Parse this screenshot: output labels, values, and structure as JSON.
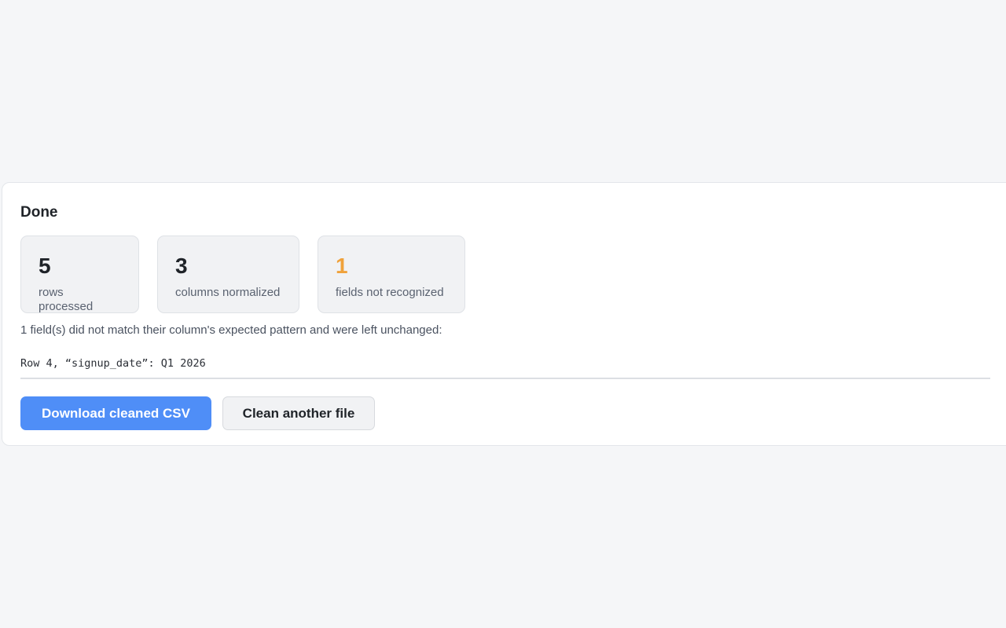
{
  "result": {
    "title": "Done",
    "stats": [
      {
        "value": "5",
        "label": "rows processed"
      },
      {
        "value": "3",
        "label": "columns normalized"
      },
      {
        "value": "1",
        "label": "fields not recognized"
      }
    ],
    "message": "1 field(s) did not match their column's expected pattern and were left unchanged:",
    "issues": [
      "Row 4, “signup_date”: Q1 2026"
    ],
    "actions": {
      "download_label": "Download cleaned CSV",
      "clean_another_label": "Clean another file"
    }
  },
  "colors": {
    "accent": "#4f8ef7",
    "warning": "#f0a23b",
    "background": "#f5f6f8"
  }
}
